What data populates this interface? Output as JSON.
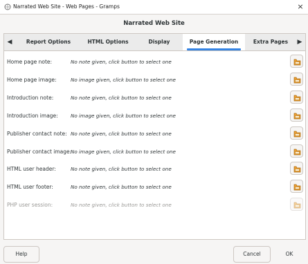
{
  "window": {
    "title": "Narrated Web Site - Web Pages - Gramps",
    "close_glyph": "×"
  },
  "header": {
    "title": "Narrated Web Site"
  },
  "tabs": {
    "scroll_left_glyph": "◀",
    "scroll_right_glyph": "▶",
    "items": [
      {
        "label": "Report Options",
        "active": false
      },
      {
        "label": "HTML Options",
        "active": false
      },
      {
        "label": "Display",
        "active": false
      },
      {
        "label": "Page Generation",
        "active": true
      },
      {
        "label": "Extra Pages",
        "active": false
      }
    ]
  },
  "rows": [
    {
      "label": "Home page note:",
      "value": "No note given, click button to select one",
      "enabled": true
    },
    {
      "label": "Home page image:",
      "value": "No image given, click button to select one",
      "enabled": true
    },
    {
      "label": "Introduction note:",
      "value": "No note given, click button to select one",
      "enabled": true
    },
    {
      "label": "Introduction image:",
      "value": "No image given, click button to select one",
      "enabled": true
    },
    {
      "label": "Publisher contact note:",
      "value": "No note given, click button to select one",
      "enabled": true
    },
    {
      "label": "Publisher contact image:",
      "value": "No image given, click button to select one",
      "enabled": true
    },
    {
      "label": "HTML user header:",
      "value": "No note given, click button to select one",
      "enabled": true
    },
    {
      "label": "HTML user footer:",
      "value": "No note given, click button to select one",
      "enabled": true
    },
    {
      "label": "PHP user session:",
      "value": "No note given, click button to select one",
      "enabled": false
    }
  ],
  "icons": {
    "select_button": "select-object-icon",
    "app": "gramps-icon"
  },
  "buttons": {
    "help": "Help",
    "cancel": "Cancel",
    "ok": "OK"
  },
  "colors": {
    "accent": "#3584e4",
    "icon_orange": "#f0a030",
    "disabled_text": "#9a9996"
  }
}
